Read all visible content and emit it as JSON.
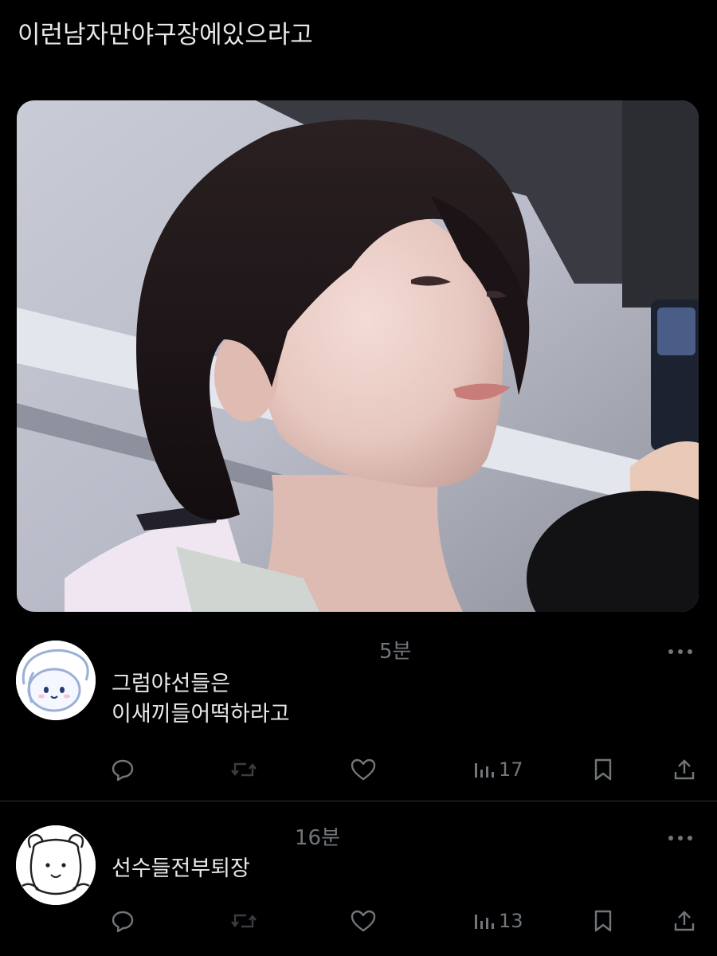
{
  "post": {
    "text": "이런남자만야구장에있으라고"
  },
  "media": {
    "description_icon": "photo"
  },
  "replies": [
    {
      "time": "5분",
      "text_line1": "그럼야선들은",
      "text_line2": "이새끼들어떡하라고",
      "views": "17",
      "avatar_icon": "cinnamoroll-avatar-icon"
    },
    {
      "time": "16분",
      "text_line1": "선수들전부퇴장",
      "text_line2": "",
      "views": "13",
      "avatar_icon": "cartoon-animal-avatar-icon"
    }
  ],
  "colors": {
    "background": "#000000",
    "text": "#e7e9ea",
    "muted": "#71767b",
    "divider": "#2f3336"
  }
}
